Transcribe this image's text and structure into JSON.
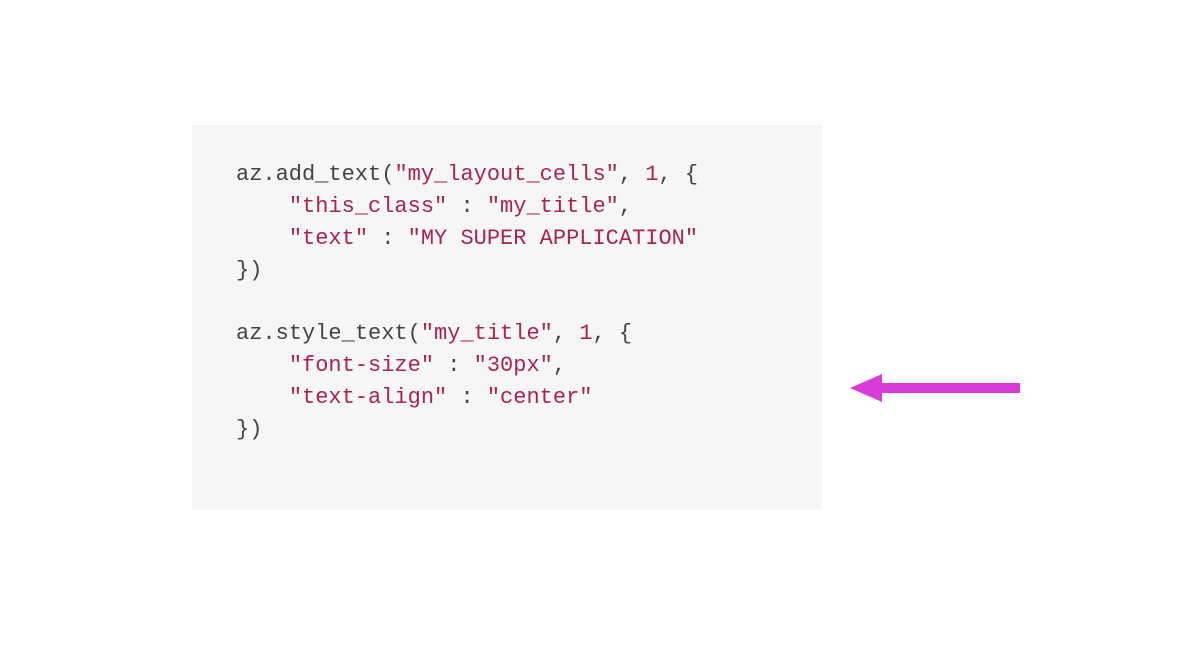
{
  "code": {
    "tokens": [
      {
        "cls": "tok-default",
        "text": "az.add_text("
      },
      {
        "cls": "tok-string",
        "text": "\"my_layout_cells\""
      },
      {
        "cls": "tok-default",
        "text": ", "
      },
      {
        "cls": "tok-number",
        "text": "1"
      },
      {
        "cls": "tok-default",
        "text": ", {\n    "
      },
      {
        "cls": "tok-string",
        "text": "\"this_class\""
      },
      {
        "cls": "tok-default",
        "text": " : "
      },
      {
        "cls": "tok-string",
        "text": "\"my_title\""
      },
      {
        "cls": "tok-default",
        "text": ",\n    "
      },
      {
        "cls": "tok-string",
        "text": "\"text\""
      },
      {
        "cls": "tok-default",
        "text": " : "
      },
      {
        "cls": "tok-string",
        "text": "\"MY SUPER APPLICATION\""
      },
      {
        "cls": "tok-default",
        "text": "\n})\n\n"
      },
      {
        "cls": "tok-default",
        "text": "az.style_text("
      },
      {
        "cls": "tok-string",
        "text": "\"my_title\""
      },
      {
        "cls": "tok-default",
        "text": ", "
      },
      {
        "cls": "tok-number",
        "text": "1"
      },
      {
        "cls": "tok-default",
        "text": ", {\n    "
      },
      {
        "cls": "tok-string",
        "text": "\"font-size\""
      },
      {
        "cls": "tok-default",
        "text": " : "
      },
      {
        "cls": "tok-string",
        "text": "\"30px\""
      },
      {
        "cls": "tok-default",
        "text": ",\n    "
      },
      {
        "cls": "tok-string",
        "text": "\"text-align\""
      },
      {
        "cls": "tok-default",
        "text": " : "
      },
      {
        "cls": "tok-string",
        "text": "\"center\""
      },
      {
        "cls": "tok-default",
        "text": "\n})"
      }
    ]
  },
  "annotation": {
    "arrow_color": "#d83bd8"
  }
}
